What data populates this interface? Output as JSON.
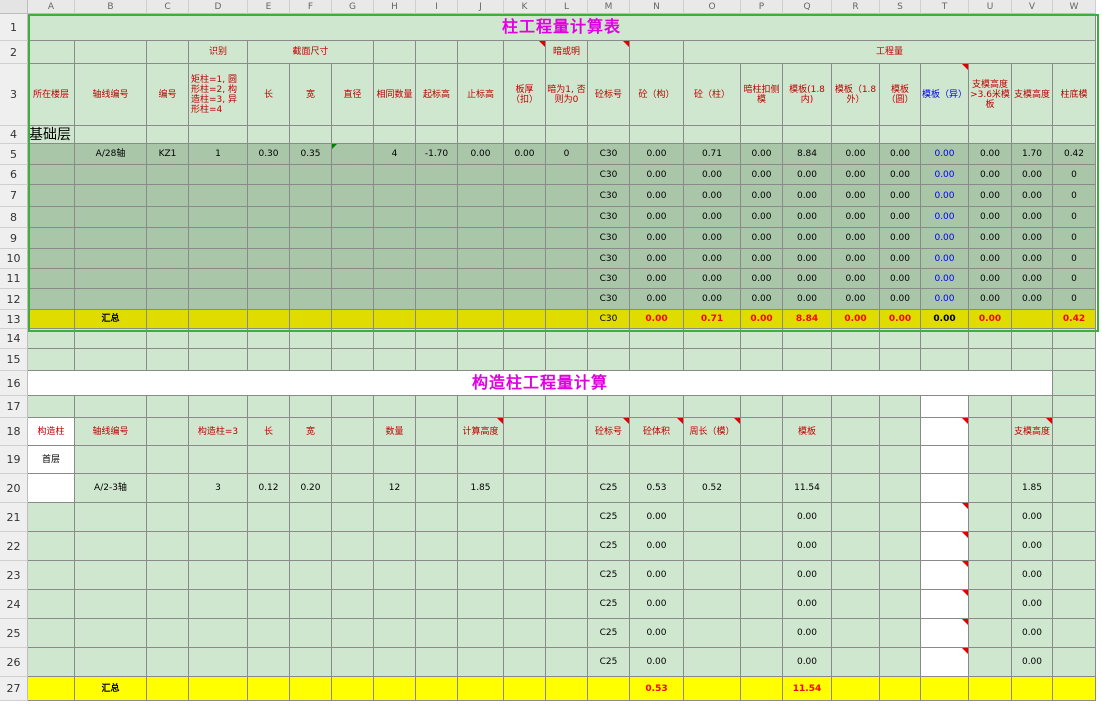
{
  "sheet": {
    "columns": [
      "A",
      "B",
      "C",
      "D",
      "E",
      "F",
      "G",
      "H",
      "I",
      "J",
      "K",
      "L",
      "M",
      "N",
      "O",
      "P",
      "Q",
      "R",
      "S",
      "T",
      "U",
      "V",
      "W"
    ],
    "title1": "柱工程量计算表",
    "title2": "构造柱工程量计算",
    "row2": {
      "identify": "识别",
      "section": "截面尺寸",
      "dark_note": "暗或明",
      "quantity": "工程量"
    },
    "row3": {
      "floor": "所在楼层",
      "axis": "轴线编号",
      "code": "编号",
      "identify_note": "矩柱=1, 圆形柱=2, 构造柱=3, 异形柱=4",
      "length": "长",
      "width": "宽",
      "diameter": "直径",
      "same_count": "相同数量",
      "start_elev": "起标高",
      "end_elev": "止标高",
      "slab": "板厚（扣）",
      "dark_rule": "暗为1, 否则为0",
      "grade": "砼标号",
      "q_conc_struct": "砼（构）",
      "q_conc_col": "砼（柱）",
      "q_hidden": "暗柱扣侧模",
      "q_form_in": "模板(1.8内)",
      "q_form_out": "模板（1.8外）",
      "q_form_round": "模板（圆）",
      "q_form_irreg": "模板（异）",
      "q_support_over": "支模高度>3.6米模板",
      "q_support_h": "支模高度",
      "q_col_base": "柱底模"
    },
    "row4": {
      "floor": "基础层"
    },
    "row5": {
      "axis": "A/28轴",
      "code": "KZ1",
      "identify": "1",
      "length": "0.30",
      "width": "0.35",
      "same_count": "4",
      "start_elev": "-1.70",
      "end_elev": "0.00",
      "slab": "0.00",
      "dark": "0",
      "grade": "C30",
      "n": "0.00",
      "o": "0.71",
      "p": "0.00",
      "q": "8.84",
      "r": "0.00",
      "s": "0.00",
      "t": "0.00",
      "u": "0.00",
      "v": "1.70",
      "w": "0.42"
    },
    "empty_rows": [
      {
        "grade": "C30",
        "n": "0.00",
        "o": "0.00",
        "p": "0.00",
        "q": "0.00",
        "r": "0.00",
        "s": "0.00",
        "t": "0.00",
        "u": "0.00",
        "v": "0.00",
        "w": "0"
      },
      {
        "grade": "C30",
        "n": "0.00",
        "o": "0.00",
        "p": "0.00",
        "q": "0.00",
        "r": "0.00",
        "s": "0.00",
        "t": "0.00",
        "u": "0.00",
        "v": "0.00",
        "w": "0"
      },
      {
        "grade": "C30",
        "n": "0.00",
        "o": "0.00",
        "p": "0.00",
        "q": "0.00",
        "r": "0.00",
        "s": "0.00",
        "t": "0.00",
        "u": "0.00",
        "v": "0.00",
        "w": "0"
      },
      {
        "grade": "C30",
        "n": "0.00",
        "o": "0.00",
        "p": "0.00",
        "q": "0.00",
        "r": "0.00",
        "s": "0.00",
        "t": "0.00",
        "u": "0.00",
        "v": "0.00",
        "w": "0"
      },
      {
        "grade": "C30",
        "n": "0.00",
        "o": "0.00",
        "p": "0.00",
        "q": "0.00",
        "r": "0.00",
        "s": "0.00",
        "t": "0.00",
        "u": "0.00",
        "v": "0.00",
        "w": "0"
      },
      {
        "grade": "C30",
        "n": "0.00",
        "o": "0.00",
        "p": "0.00",
        "q": "0.00",
        "r": "0.00",
        "s": "0.00",
        "t": "0.00",
        "u": "0.00",
        "v": "0.00",
        "w": "0"
      },
      {
        "grade": "C30",
        "n": "0.00",
        "o": "0.00",
        "p": "0.00",
        "q": "0.00",
        "r": "0.00",
        "s": "0.00",
        "t": "0.00",
        "u": "0.00",
        "v": "0.00",
        "w": "0"
      }
    ],
    "row13": {
      "label": "汇总",
      "grade": "C30",
      "n": "0.00",
      "o": "0.71",
      "p": "0.00",
      "q": "8.84",
      "r": "0.00",
      "s": "0.00",
      "t": "0.00",
      "u": "0.00",
      "w": "0.42"
    },
    "row18": {
      "col_type": "构造柱",
      "axis": "轴线编号",
      "identify": "构造柱=3",
      "length": "长",
      "width": "宽",
      "count": "数量",
      "calc_height": "计算高度",
      "grade": "砼标号",
      "volume": "砼体积",
      "perimeter": "周长（模）",
      "formwork": "模板",
      "support_h": "支模高度"
    },
    "row19": {
      "floor": "首层"
    },
    "row20": {
      "axis": "A/2-3轴",
      "identify": "3",
      "length": "0.12",
      "width": "0.20",
      "count": "12",
      "calc_height": "1.85",
      "grade": "C25",
      "volume": "0.53",
      "perimeter": "0.52",
      "formwork": "11.54",
      "support_h": "1.85"
    },
    "gz_rows": [
      {
        "grade": "C25",
        "volume": "0.00",
        "formwork": "0.00",
        "support_h": "0.00"
      },
      {
        "grade": "C25",
        "volume": "0.00",
        "formwork": "0.00",
        "support_h": "0.00"
      },
      {
        "grade": "C25",
        "volume": "0.00",
        "formwork": "0.00",
        "support_h": "0.00"
      },
      {
        "grade": "C25",
        "volume": "0.00",
        "formwork": "0.00",
        "support_h": "0.00"
      },
      {
        "grade": "C25",
        "volume": "0.00",
        "formwork": "0.00",
        "support_h": "0.00"
      },
      {
        "grade": "C25",
        "volume": "0.00",
        "formwork": "0.00",
        "support_h": "0.00"
      }
    ],
    "row27": {
      "label": "汇总",
      "volume": "0.53",
      "formwork": "11.54"
    },
    "row_numbers": [
      "1",
      "2",
      "3",
      "4",
      "5",
      "6",
      "7",
      "8",
      "9",
      "10",
      "11",
      "12",
      "13",
      "14",
      "15",
      "16",
      "17",
      "18",
      "19",
      "20",
      "21",
      "22",
      "23",
      "24",
      "25",
      "26",
      "27"
    ],
    "colors": {
      "green_fill": "#cfe7cf",
      "dark_green_fill": "#a9c6a9",
      "yellow_fill": "#ffff00",
      "olive_fill": "#e1dc00",
      "title_magenta": "#e000e0",
      "header_red": "#c00000"
    }
  }
}
